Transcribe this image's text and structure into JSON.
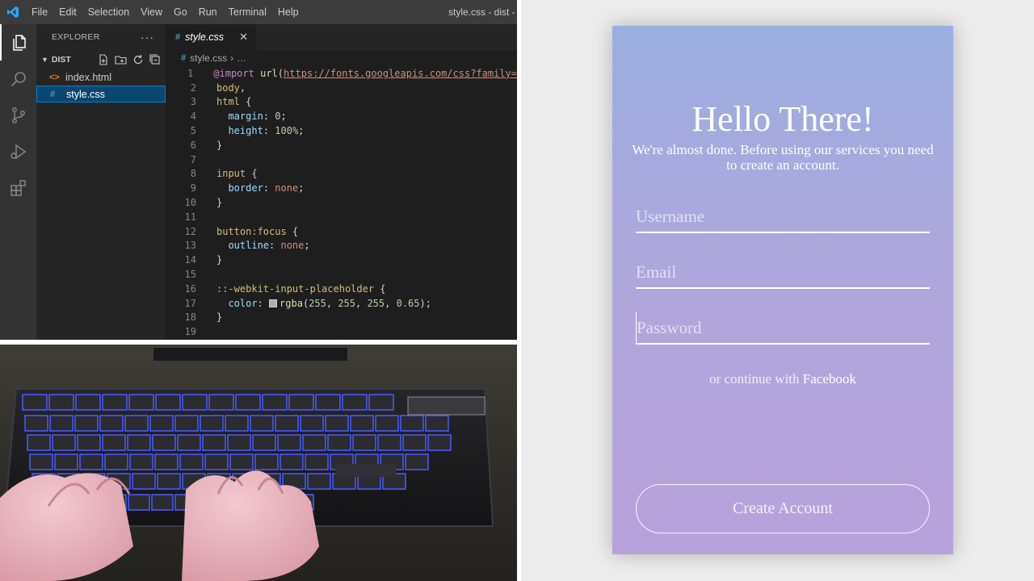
{
  "vscode": {
    "menu": [
      "File",
      "Edit",
      "Selection",
      "View",
      "Go",
      "Run",
      "Terminal",
      "Help"
    ],
    "window_title": "style.css - dist - V",
    "explorer": {
      "title": "EXPLORER",
      "more": "···",
      "folder": "DIST",
      "files": [
        {
          "name": "index.html",
          "icon": "html-file-icon"
        },
        {
          "name": "style.css",
          "icon": "css-file-icon",
          "selected": true
        }
      ]
    },
    "tab": {
      "label": "style.css",
      "close": "✕"
    },
    "breadcrumb": {
      "file": "style.css",
      "rest": "…"
    },
    "code_lines": [
      {
        "n": "1",
        "tokens": [
          [
            "kw",
            "@import"
          ],
          [
            "pun",
            " "
          ],
          [
            "fn",
            "url"
          ],
          [
            "pun",
            "("
          ],
          [
            "url",
            "https://fonts.googleapis.com/css?family="
          ]
        ]
      },
      {
        "n": "2",
        "tokens": [
          [
            "sel",
            "body"
          ],
          [
            "pun",
            ","
          ]
        ]
      },
      {
        "n": "3",
        "tokens": [
          [
            "sel",
            "html"
          ],
          [
            "pun",
            " {"
          ]
        ]
      },
      {
        "n": "4",
        "tokens": [
          [
            "pun",
            "  "
          ],
          [
            "prop",
            "margin"
          ],
          [
            "pun",
            ": "
          ],
          [
            "num",
            "0"
          ],
          [
            "pun",
            ";"
          ]
        ]
      },
      {
        "n": "5",
        "tokens": [
          [
            "pun",
            "  "
          ],
          [
            "prop",
            "height"
          ],
          [
            "pun",
            ": "
          ],
          [
            "num",
            "100%"
          ],
          [
            "pun",
            ";"
          ]
        ]
      },
      {
        "n": "6",
        "tokens": [
          [
            "pun",
            "}"
          ]
        ]
      },
      {
        "n": "7",
        "tokens": []
      },
      {
        "n": "8",
        "tokens": [
          [
            "sel",
            "input"
          ],
          [
            "pun",
            " {"
          ]
        ]
      },
      {
        "n": "9",
        "tokens": [
          [
            "pun",
            "  "
          ],
          [
            "prop",
            "border"
          ],
          [
            "pun",
            ": "
          ],
          [
            "val",
            "none"
          ],
          [
            "pun",
            ";"
          ]
        ]
      },
      {
        "n": "10",
        "tokens": [
          [
            "pun",
            "}"
          ]
        ]
      },
      {
        "n": "11",
        "tokens": []
      },
      {
        "n": "12",
        "tokens": [
          [
            "sel",
            "button:focus"
          ],
          [
            "pun",
            " {"
          ]
        ]
      },
      {
        "n": "13",
        "tokens": [
          [
            "pun",
            "  "
          ],
          [
            "prop",
            "outline"
          ],
          [
            "pun",
            ": "
          ],
          [
            "val",
            "none"
          ],
          [
            "pun",
            ";"
          ]
        ]
      },
      {
        "n": "14",
        "tokens": [
          [
            "pun",
            "}"
          ]
        ]
      },
      {
        "n": "15",
        "tokens": []
      },
      {
        "n": "16",
        "tokens": [
          [
            "sel",
            "::-webkit-input-placeholder"
          ],
          [
            "pun",
            " {"
          ]
        ]
      },
      {
        "n": "17",
        "tokens": [
          [
            "pun",
            "  "
          ],
          [
            "prop",
            "color"
          ],
          [
            "pun",
            ": "
          ],
          [
            "swatch",
            ""
          ],
          [
            "fn",
            "rgba"
          ],
          [
            "pun",
            "("
          ],
          [
            "num",
            "255"
          ],
          [
            "pun",
            ", "
          ],
          [
            "num",
            "255"
          ],
          [
            "pun",
            ", "
          ],
          [
            "num",
            "255"
          ],
          [
            "pun",
            ", "
          ],
          [
            "num",
            "0.65"
          ],
          [
            "pun",
            ");"
          ]
        ]
      },
      {
        "n": "18",
        "tokens": [
          [
            "pun",
            "}"
          ]
        ]
      },
      {
        "n": "19",
        "tokens": []
      }
    ]
  },
  "signup": {
    "title": "Hello There!",
    "subtitle": "We're almost done. Before using our services you need to create an account.",
    "username_placeholder": "Username",
    "email_placeholder": "Email",
    "password_placeholder": "Password",
    "alt_prefix": "or continue with ",
    "alt_link": "Facebook",
    "submit": "Create Account"
  },
  "colors": {
    "card_top": "#9aaee0",
    "card_bottom": "#b8a2db",
    "vscode_accent": "#007fd4"
  }
}
